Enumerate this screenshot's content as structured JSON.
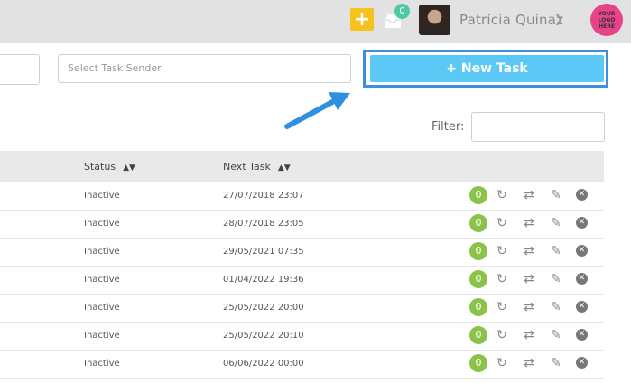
{
  "header": {
    "inbox_count": "0",
    "user_name": "Patrícia Quinaz",
    "logo_lines": [
      "YOUR",
      "LOGO",
      "HERE"
    ],
    "accent_color": "#f7c21d"
  },
  "toolbar": {
    "sender_placeholder": "Select Task Sender",
    "new_task_label": "+ New Task",
    "filter_label": "Filter:"
  },
  "table": {
    "headers": {
      "status": "Status",
      "next_task": "Next Task"
    },
    "rows": [
      {
        "status": "Inactive",
        "next_task": "27/07/2018 23:07",
        "count": "0"
      },
      {
        "status": "Inactive",
        "next_task": "28/07/2018 23:05",
        "count": "0"
      },
      {
        "status": "Inactive",
        "next_task": "29/05/2021 07:35",
        "count": "0"
      },
      {
        "status": "Inactive",
        "next_task": "01/04/2022 19:36",
        "count": "0"
      },
      {
        "status": "Inactive",
        "next_task": "25/05/2022 20:00",
        "count": "0"
      },
      {
        "status": "Inactive",
        "next_task": "25/05/2022 20:10",
        "count": "0"
      },
      {
        "status": "Inactive",
        "next_task": "06/06/2022 00:00",
        "count": "0"
      }
    ]
  }
}
